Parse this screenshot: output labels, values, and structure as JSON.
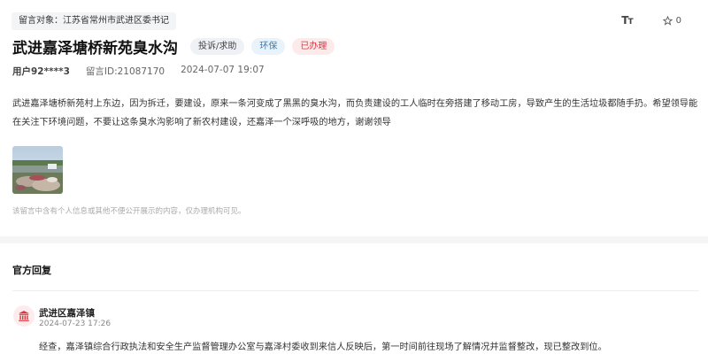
{
  "message": {
    "target_label": "留言对象：江苏省常州市武进区委书记",
    "title": "武进嘉泽塘桥新苑臭水沟",
    "tags": {
      "type": "投诉/求助",
      "domain": "环保",
      "status": "已办理"
    },
    "user": "用户92****3",
    "id_text": "留言ID:21087170",
    "datetime": "2024-07-07 19:07",
    "body": "武进嘉泽塘桥新苑村上东边，因为拆迁，要建设，原来一条河变成了黑黑的臭水沟，而负责建设的工人临时在旁搭建了移动工房，导致产生的生活垃圾都随手扔。希望领导能在关注下环境问题，不要让这条臭水沟影响了新农村建设，还嘉泽一个深呼吸的地方，谢谢领导",
    "privacy_note": "该留言中含有个人信息或其他不便公开展示的内容，仅办理机构可见。"
  },
  "toolbar": {
    "font_icon": "font-size-icon",
    "favorite_icon": "star-outline-icon",
    "favorite_count": "0"
  },
  "reply": {
    "heading": "官方回复",
    "org_icon": "government-building-icon",
    "org": "武进区嘉泽镇",
    "time": "2024-07-23 17:26",
    "content": "经查，嘉泽镇综合行政执法和安全生产监督管理办公室与嘉泽村委收到来信人反映后，第一时间前往现场了解情况并监督整改，现已整改到位。"
  },
  "colors": {
    "status_red": "#d9363e",
    "domain_blue": "#2a7fc4",
    "separator_gray": "#f5f5f7"
  }
}
